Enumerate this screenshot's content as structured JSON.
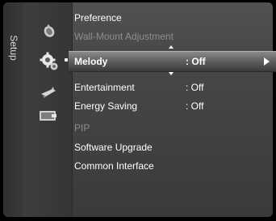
{
  "sidebar": {
    "label": "Setup"
  },
  "menu": {
    "items": [
      {
        "label": "Preference",
        "value": "",
        "state": "normal"
      },
      {
        "label": "Wall-Mount Adjustment",
        "value": "",
        "state": "disabled"
      },
      {
        "label": "Melody",
        "value": ": Off",
        "state": "selected"
      },
      {
        "label": "Entertainment",
        "value": ": Off",
        "state": "normal"
      },
      {
        "label": "Energy Saving",
        "value": ": Off",
        "state": "normal"
      },
      {
        "label": "PIP",
        "value": "",
        "state": "disabled"
      },
      {
        "label": "Software Upgrade",
        "value": "",
        "state": "normal"
      },
      {
        "label": "Common Interface",
        "value": "",
        "state": "normal"
      }
    ]
  },
  "icons": [
    "satellite-dish-icon",
    "gear-icon",
    "rocket-icon",
    "input-icon"
  ],
  "colors": {
    "background": "#3b3b3b",
    "text": "#ffffff",
    "disabled_text": "#8e8e8e",
    "highlight": "#6e6e6e"
  }
}
